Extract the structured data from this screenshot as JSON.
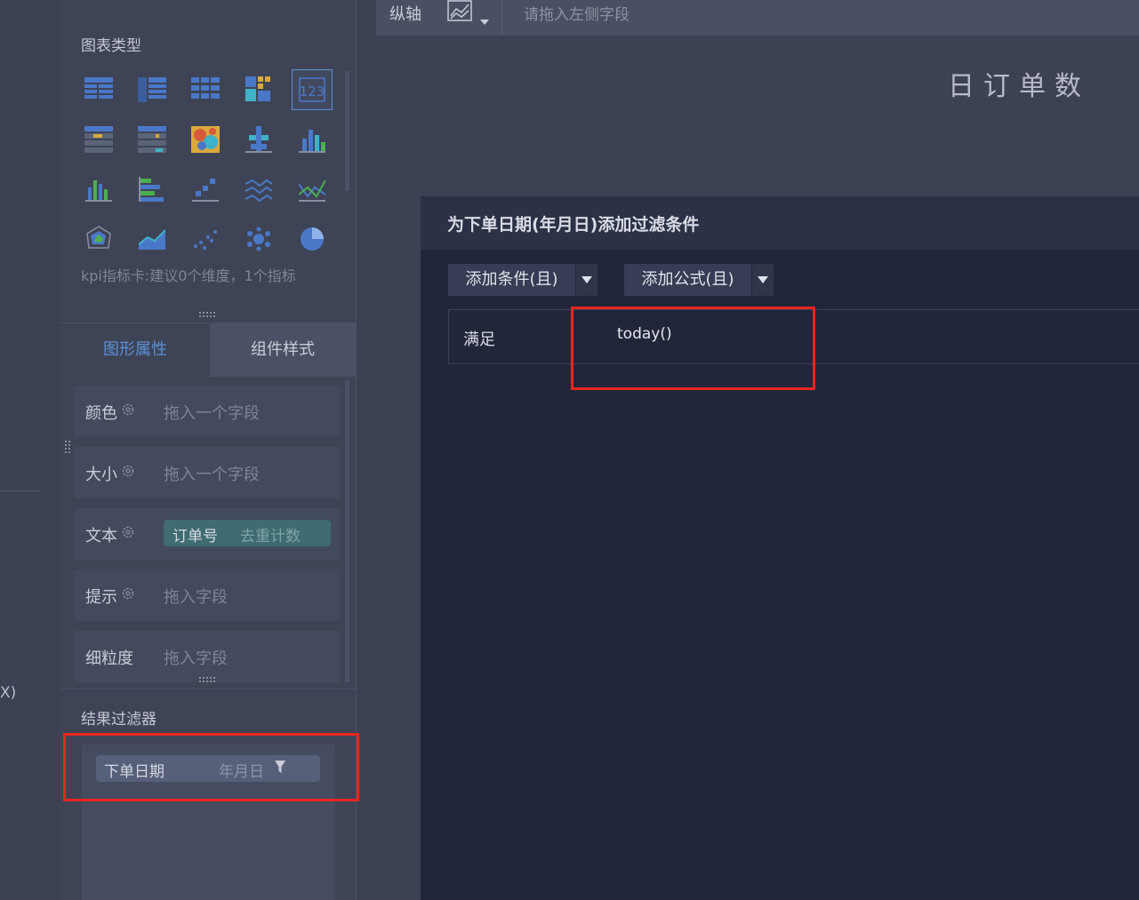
{
  "axis_bar": {
    "label": "纵轴",
    "placeholder": "请拖入左侧字段",
    "icon": "line-chart-icon"
  },
  "preview": {
    "title": "日订单数"
  },
  "left_strip": {
    "cut_text": "X)"
  },
  "chart_types": {
    "title": "图表类型",
    "hint": "kpi指标卡:建议0个维度，1个指标",
    "selected": "kpi-card",
    "items": [
      "table",
      "cross-table",
      "grouped-table",
      "color-table",
      "kpi-card",
      "range-table",
      "progress-table",
      "heatmap",
      "grouped-bar",
      "stacked-bar",
      "column",
      "bar",
      "step-line",
      "multi-line",
      "line-compare",
      "radar",
      "area",
      "scatter",
      "bubble",
      "pie"
    ]
  },
  "property_tabs": {
    "shape": "图形属性",
    "style": "组件样式"
  },
  "properties": [
    {
      "label": "颜色",
      "placeholder": "拖入一个字段",
      "has_gear": true
    },
    {
      "label": "大小",
      "placeholder": "拖入一个字段",
      "has_gear": true
    },
    {
      "label": "文本",
      "field": "订单号",
      "agg": "去重计数",
      "has_gear": true
    },
    {
      "label": "提示",
      "placeholder": "拖入字段",
      "has_gear": true
    },
    {
      "label": "细粒度",
      "placeholder": "拖入字段",
      "has_gear": false
    }
  ],
  "result_filter": {
    "title": "结果过滤器",
    "field": "下单日期",
    "granularity": "年月日"
  },
  "dialog": {
    "title": "为下单日期(年月日)添加过滤条件",
    "add_condition": "添加条件(且)",
    "add_formula": "添加公式(且)",
    "condition": {
      "label": "满足",
      "formula": "today()"
    }
  },
  "colors": {
    "accent": "#5c8fd6",
    "highlight": "#e8261f",
    "dialog_bg": "#21263a"
  }
}
